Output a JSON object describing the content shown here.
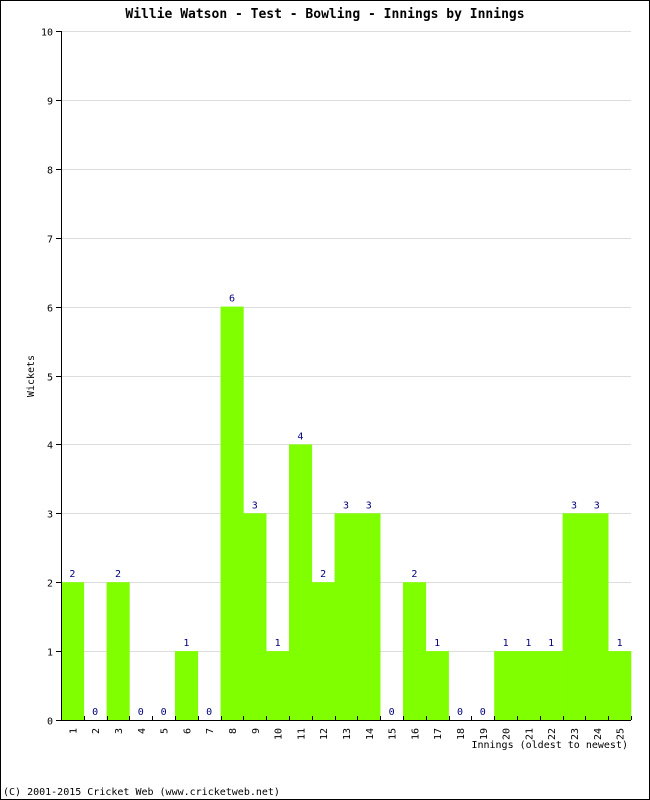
{
  "chart_data": {
    "type": "bar",
    "title": "Willie Watson - Test - Bowling - Innings by Innings",
    "xlabel": "Innings (oldest to newest)",
    "ylabel": "Wickets",
    "ylim": [
      0,
      10
    ],
    "yticks": [
      0,
      1,
      2,
      3,
      4,
      5,
      6,
      7,
      8,
      9,
      10
    ],
    "grid": true,
    "categories": [
      "1",
      "2",
      "3",
      "4",
      "5",
      "6",
      "7",
      "8",
      "9",
      "10",
      "11",
      "12",
      "13",
      "14",
      "15",
      "16",
      "17",
      "18",
      "19",
      "20",
      "21",
      "22",
      "23",
      "24",
      "25"
    ],
    "values": [
      2,
      0,
      2,
      0,
      0,
      1,
      0,
      6,
      3,
      1,
      4,
      2,
      3,
      3,
      0,
      2,
      1,
      0,
      0,
      1,
      1,
      1,
      3,
      3,
      1
    ],
    "bar_color": "#80ff00",
    "label_color": "#000080",
    "grid_color": "#dddddd"
  },
  "footer": {
    "copyright": "(C) 2001-2015 Cricket Web (www.cricketweb.net)"
  }
}
